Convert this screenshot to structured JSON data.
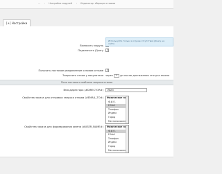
{
  "breadcrumbs": [
    "...",
    "Настройки модулей",
    "Индикатор: сборщик отзывов"
  ],
  "tabs": [
    {
      "label": "[+] Настройки"
    }
  ],
  "settings": {
    "enable_module": "Включить модуль",
    "enable_module_checked": true,
    "connect_jquery": "Подключить jQuery",
    "connect_jquery_checked": true,
    "note_text": "Используйте только в случае отсутствия jQuery на сайте",
    "get_notification": "Получать почтовое уведомление о новом отзыве",
    "get_notification_checked": true,
    "request_label": "Запросить отзыв у покупателя",
    "request_prefix": "через",
    "request_days": "1",
    "request_suffix": "дн после достижения статуса заказа"
  },
  "section": {
    "title": "Поля почтового шаблона запроса отзыва"
  },
  "director": {
    "label": "Имя директора (#DIRECTOR#)",
    "value": "Иван"
  },
  "list1": {
    "label": "Свойства заказа для отправки запроса отзыва (#EMAIL_TO#)",
    "items": [
      {
        "text": "Физическое лицо",
        "group": true,
        "selected": false
      },
      {
        "text": "Ф.И.О.",
        "group": false,
        "selected": false
      },
      {
        "text": "E-Mail",
        "group": false,
        "selected": true
      },
      {
        "text": "Телефон",
        "group": false,
        "selected": false
      },
      {
        "text": "Индекс",
        "group": false,
        "selected": false
      },
      {
        "text": "Город",
        "group": false,
        "selected": false
      },
      {
        "text": "Местоположение",
        "group": false,
        "selected": false
      }
    ]
  },
  "list2": {
    "label": "Свойства заказа для формирования имени (#USER_NAME#)",
    "items": [
      {
        "text": "Физическое лицо",
        "group": true,
        "selected": false
      },
      {
        "text": "Ф.И.О.",
        "group": false,
        "selected": true
      },
      {
        "text": "E-Mail",
        "group": false,
        "selected": false
      },
      {
        "text": "Телефон",
        "group": false,
        "selected": false
      },
      {
        "text": "Индекс",
        "group": false,
        "selected": false
      },
      {
        "text": "Город",
        "group": false,
        "selected": false
      },
      {
        "text": "Местоположение",
        "group": false,
        "selected": false
      }
    ]
  }
}
